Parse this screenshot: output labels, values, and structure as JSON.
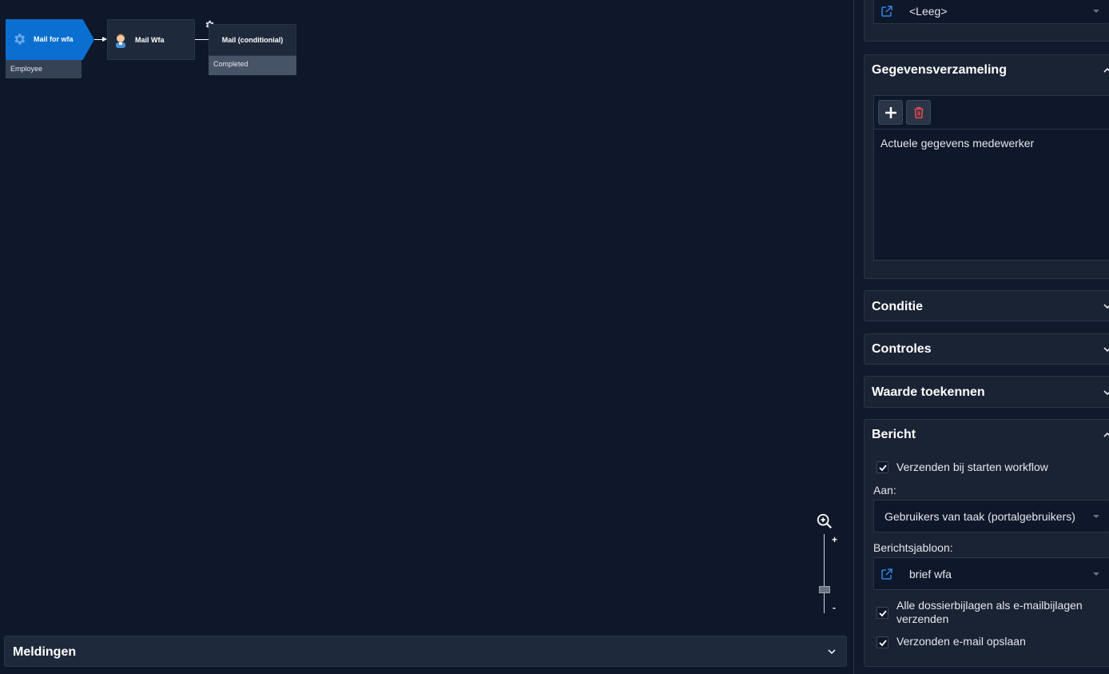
{
  "workflow": {
    "start_node": {
      "label": "Mail for wfa",
      "sublabel": "Employee"
    },
    "task_node": {
      "label": "Mail Wfa"
    },
    "conditional_node": {
      "label": "Mail (conditionial)",
      "sublabel": "Completed"
    }
  },
  "zoom": {
    "plus": "+",
    "minus": "-"
  },
  "meldingen": {
    "title": "Meldingen"
  },
  "panel": {
    "top_field": {
      "value": "<Leeg>"
    },
    "gegevens": {
      "title": "Gegevensverzameling",
      "items": [
        "Actuele gegevens medewerker"
      ]
    },
    "conditie": {
      "title": "Conditie"
    },
    "controles": {
      "title": "Controles"
    },
    "waarde": {
      "title": "Waarde toekennen"
    },
    "bericht": {
      "title": "Bericht",
      "check_send_on_start": "Verzenden bij starten workflow",
      "aan_label": "Aan:",
      "aan_value": "Gebruikers van taak (portalgebruikers)",
      "template_label": "Berichtsjabloon:",
      "template_value": "brief wfa",
      "check_attachments": "Alle dossierbijlagen als e-mailbijlagen verzenden",
      "check_save_mail": "Verzonden e-mail opslaan"
    }
  },
  "colors": {
    "accent": "#0a6fd1",
    "delete": "#e5484d",
    "background": "#0f172a"
  }
}
